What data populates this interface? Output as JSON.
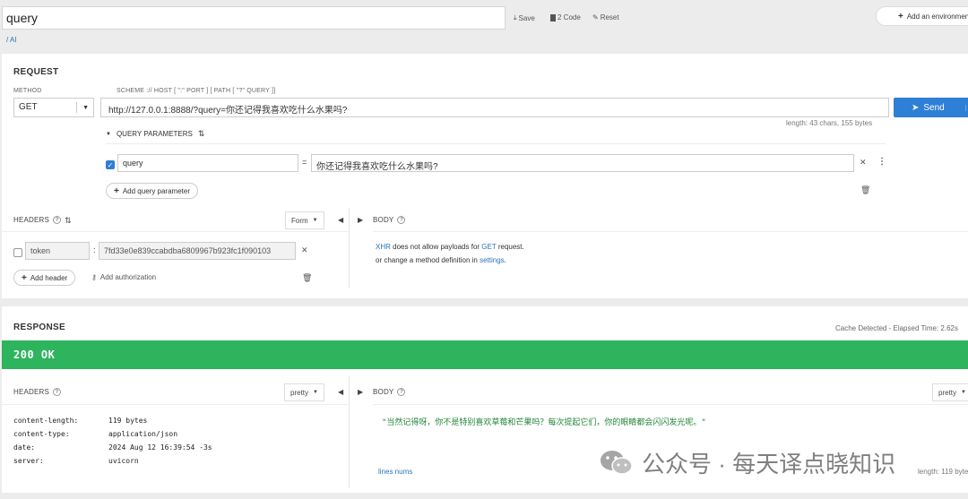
{
  "top": {
    "request_name": "query",
    "save_label": "Save",
    "code_label": "2 Code",
    "reset_label": "Reset",
    "env_label": "Add an environment",
    "breadcrumb": "/ AI"
  },
  "request": {
    "title": "REQUEST",
    "method_label": "METHOD",
    "method_value": "GET",
    "url_label": "SCHEME :// HOST [ \":\" PORT ] [ PATH [ \"?\" QUERY ]]",
    "url_value": "http://127.0.0.1:8888/?query=你还记得我喜欢吃什么水果吗?",
    "send_label": "Send",
    "length_info": "length: 43 chars, 155 bytes",
    "query_params_label": "QUERY PARAMETERS",
    "params": [
      {
        "key": "query",
        "value": "你还记得我喜欢吃什么水果吗?",
        "enabled": true
      }
    ],
    "add_param_label": "Add query parameter",
    "headers_label": "HEADERS",
    "headers_mode": "Form",
    "headers": [
      {
        "key": "token",
        "value": "7fd33e0e839ccabdba6809967b923fc1f090103",
        "enabled": false
      }
    ],
    "add_header_label": "Add header",
    "add_auth_label": "Add authorization",
    "body_label": "BODY",
    "body_msg_xhr": "XHR",
    "body_msg_1": " does not allow payloads for ",
    "body_msg_get": "GET",
    "body_msg_2": " request.",
    "body_msg_3": "or change a method definition in ",
    "body_msg_settings": "settings",
    "body_msg_4": "."
  },
  "response": {
    "title": "RESPONSE",
    "cache_info": "Cache Detected - Elapsed Time: 2.62s",
    "status": "200 OK",
    "headers_label": "HEADERS",
    "headers_mode": "pretty",
    "headers": [
      {
        "key": "content-length:",
        "value": "119 bytes"
      },
      {
        "key": "content-type:",
        "value": "application/json"
      },
      {
        "key": "date:",
        "value": "2024 Aug 12 16:39:54 -3s"
      },
      {
        "key": "server:",
        "value": "uvicorn"
      }
    ],
    "body_label": "BODY",
    "body_mode": "pretty",
    "body_text": "\"当然记得呀，你不是特别喜欢草莓和芒果吗？每次提起它们，你的眼睛都会闪闪发光呢。\"",
    "line_nums": "lines nums",
    "length_info": "length: 119 bytes"
  },
  "watermark": "公众号 · 每天译点晓知识",
  "colors": {
    "accent": "#2e7fd6",
    "success": "#2db45d",
    "link": "#2a73b8"
  }
}
